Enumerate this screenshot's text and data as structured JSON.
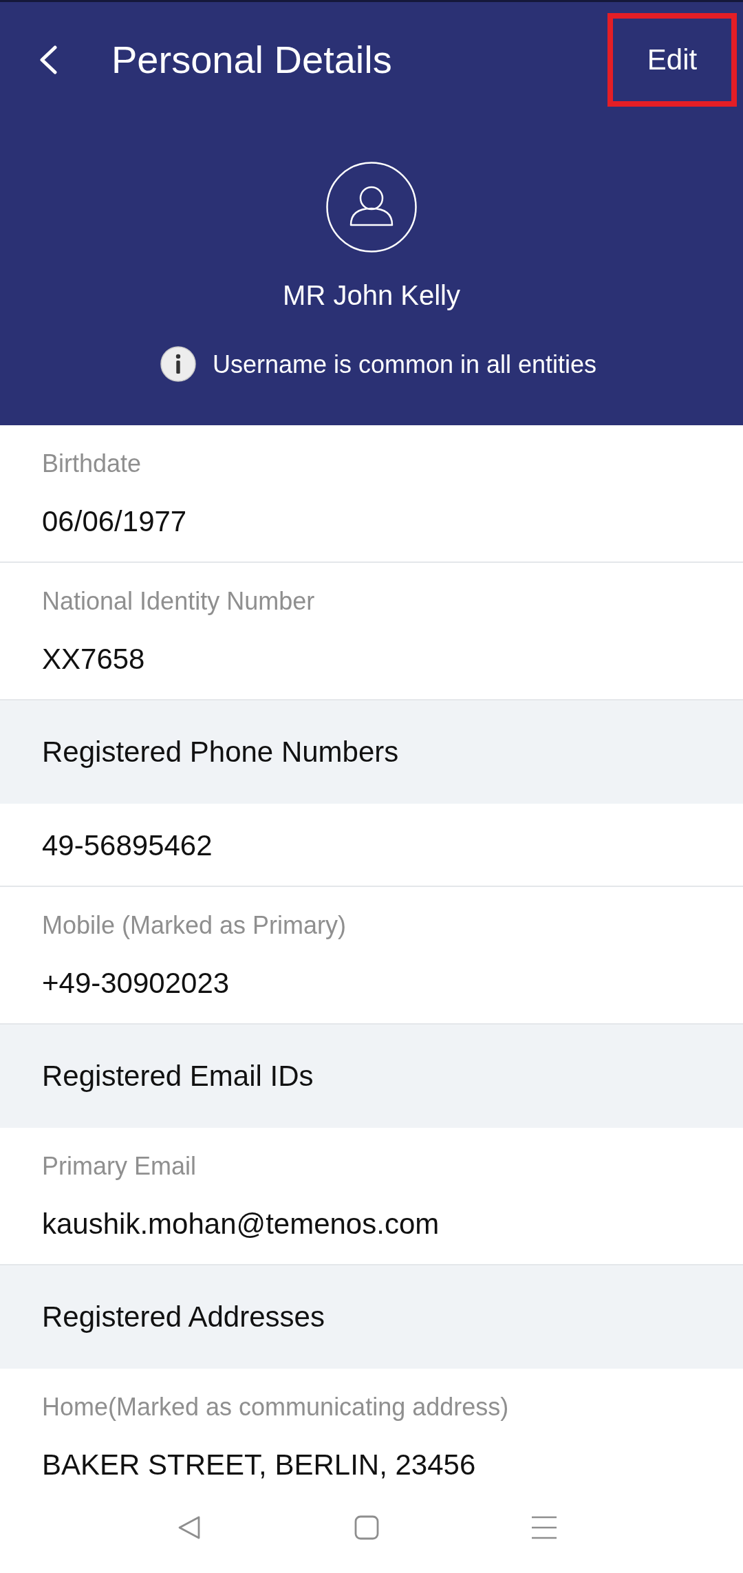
{
  "header": {
    "title": "Personal Details",
    "action": {
      "label": "Edit",
      "highlighted": true
    }
  },
  "profile": {
    "name": "MR John Kelly",
    "notice": "Username is common in all entities"
  },
  "details": [
    {
      "kind": "field",
      "label": "Birthdate",
      "value": "06/06/1977"
    },
    {
      "kind": "field",
      "label": "National Identity Number",
      "value": "XX7658"
    },
    {
      "kind": "section",
      "title": "Registered Phone Numbers"
    },
    {
      "kind": "value",
      "value": "49-56895462"
    },
    {
      "kind": "field",
      "label": "Mobile (Marked as Primary)",
      "value": "+49-30902023"
    },
    {
      "kind": "section",
      "title": "Registered Email IDs"
    },
    {
      "kind": "field",
      "label": "Primary Email",
      "value": "kaushik.mohan@temenos.com"
    },
    {
      "kind": "section",
      "title": "Registered Addresses"
    },
    {
      "kind": "field",
      "label": "Home(Marked as communicating address)",
      "value": "BAKER STREET, BERLIN, 23456"
    }
  ]
}
